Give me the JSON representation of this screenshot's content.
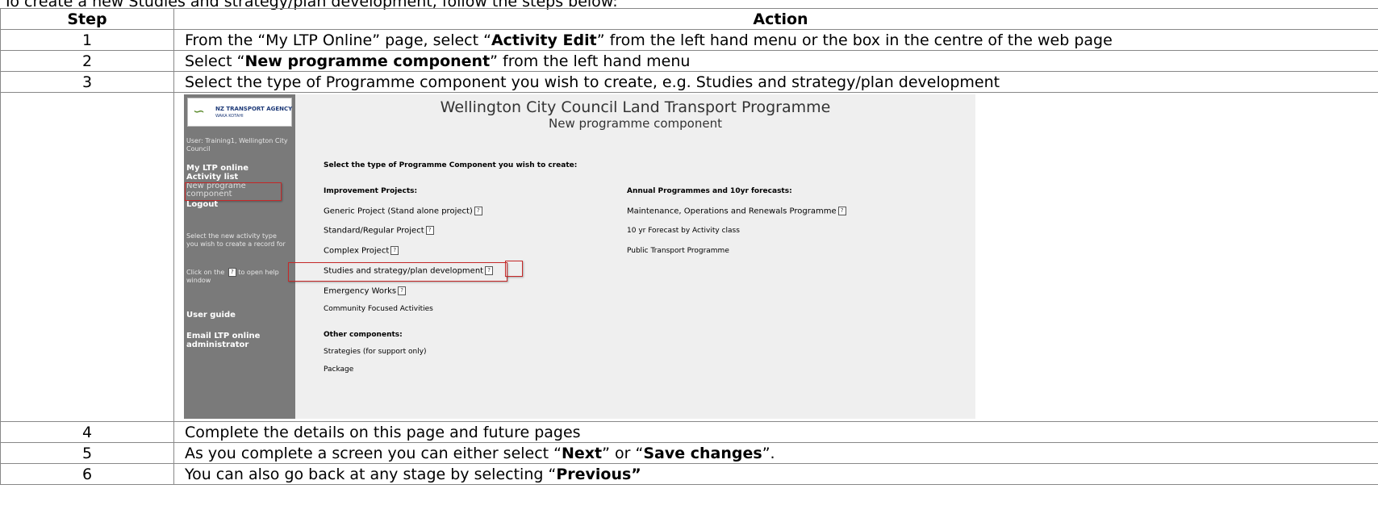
{
  "intro": "To create a new Studies and strategy/plan development, follow the steps below:",
  "headers": {
    "step": "Step",
    "action": "Action"
  },
  "rows": [
    {
      "step": "1",
      "a": "From the “My LTP Online” page, select “",
      "b": "Activity Edit",
      "c": "” from the left hand menu or the box in the centre of the web page"
    },
    {
      "step": "2",
      "a": "Select “",
      "b": "New programme component",
      "c": "” from the left hand menu"
    },
    {
      "step": "3",
      "text": "Select the type of Programme component you wish to create, e.g. Studies and strategy/plan development"
    },
    {
      "step": "4",
      "text": "Complete the details on this page and future pages"
    },
    {
      "step": "5",
      "a": "As you complete a screen you can either select “",
      "b": "Next",
      "c": "” or “",
      "d": "Save changes",
      "e": "”."
    },
    {
      "step": "6",
      "a": "You can also go back at any stage by selecting “",
      "b": "Previous”"
    }
  ],
  "screenshot": {
    "logo_agency": "NZ TRANSPORT AGENCY",
    "logo_maori": "WAKA KOTAHI",
    "user": "User: Training1, Wellington City Council",
    "nav": {
      "my_ltp": "My LTP online",
      "activity_list": "Activity list",
      "new_component": "New programe component",
      "logout": "Logout"
    },
    "side_hint": "Select the new activity type you wish to create a record for",
    "help_hint_a": "Click on the",
    "help_hint_b": "to open help window",
    "user_guide": "User guide",
    "email_admin": "Email LTP online administrator",
    "title": "Wellington City Council Land Transport Programme",
    "subtitle": "New programme component",
    "prompt": "Select the type of Programme Component you wish to create:",
    "improvement_heading": "Improvement Projects:",
    "generic": "Generic Project (Stand alone project)",
    "standard": "Standard/Regular Project",
    "complex": "Complex Project",
    "studies": "Studies and strategy/plan development",
    "emergency": "Emergency Works",
    "community": "Community Focused Activities",
    "other_heading": "Other components:",
    "strategies": "Strategies (for support only)",
    "package": "Package",
    "annual_heading": "Annual Programmes and 10yr forecasts:",
    "maintenance": "Maintenance, Operations and Renewals Programme",
    "forecast": "10 yr Forecast by Activity class",
    "public_transport": "Public Transport Programme",
    "help_glyph": "?"
  }
}
